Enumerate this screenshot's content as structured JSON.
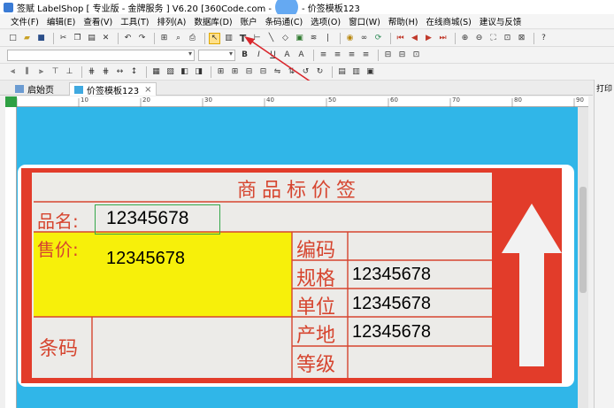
{
  "window": {
    "title": "签赋 LabelShop [ 专业版 - 金牌服务 ]  V6.20  [360Code.com - ",
    "title_tail": "- 价签模板123"
  },
  "menu": [
    "文件(F)",
    "编辑(E)",
    "查看(V)",
    "工具(T)",
    "排列(A)",
    "数据库(D)",
    "账户",
    "条码通(C)",
    "选项(O)",
    "窗口(W)",
    "帮助(H)",
    "在线商城(S)",
    "建议与反馈"
  ],
  "tabs": [
    {
      "label": "启始页"
    },
    {
      "label": "价签模板123"
    }
  ],
  "right_panel": {
    "title": "打印"
  },
  "label": {
    "header": "商品标价签",
    "name_label": "品名:",
    "name_value": "12345678",
    "price_label": "售价:",
    "price_value": "12345678",
    "barcode_label": "条码",
    "code_label": "编码",
    "spec_label": "规格",
    "spec_value": "12345678",
    "unit_label": "单位",
    "unit_value": "12345678",
    "origin_label": "产地",
    "origin_value": "12345678",
    "grade_label": "等级"
  },
  "ruler": [
    "10",
    "20",
    "30",
    "40",
    "50",
    "60",
    "70",
    "80",
    "90"
  ],
  "colors": {
    "canvas": "#30b6e8",
    "label_red": "#e23c2a",
    "price_yellow": "#f7f00a",
    "accent_arrow": "#d9262c"
  }
}
